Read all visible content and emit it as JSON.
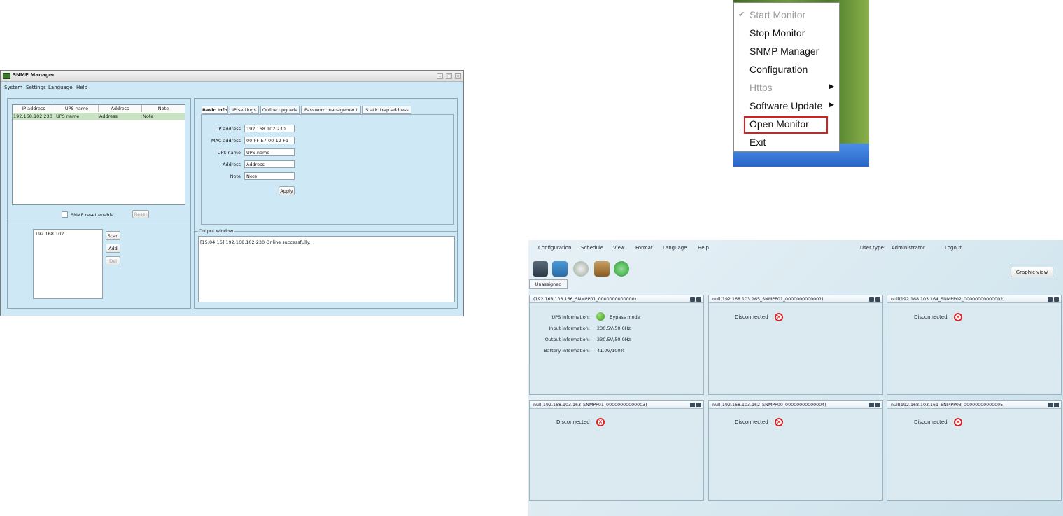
{
  "snmp_manager": {
    "title": "SNMP Manager",
    "menu": [
      "System",
      "Settings",
      "Language",
      "Help"
    ],
    "table": {
      "columns": [
        "IP address",
        "UPS name",
        "Address",
        "Note"
      ],
      "rows": [
        [
          "192.168.102.230",
          "UPS name",
          "Address",
          "Note"
        ]
      ]
    },
    "reset_checkbox_label": "SNMP reset enable",
    "reset_button": "Reset",
    "ip_list": [
      "192.168.102"
    ],
    "scan_button": "Scan",
    "add_button": "Add",
    "del_button": "Del",
    "tabs": [
      "Basic Info",
      "IP settings",
      "Online upgrade",
      "Password management",
      "Static trap address"
    ],
    "fields": [
      {
        "label": "IP address",
        "value": "192.168.102.230"
      },
      {
        "label": "MAC address",
        "value": "00-FF-E7-00-12-F1"
      },
      {
        "label": "UPS name",
        "value": "UPS name"
      },
      {
        "label": "Address",
        "value": "Address"
      },
      {
        "label": "Note",
        "value": "Note"
      }
    ],
    "apply_button": "Apply",
    "output_window_label": "Output window",
    "output_log": "[15:04:16]  192.168.102.230 Online successfully."
  },
  "tray_menu": {
    "items": [
      {
        "label": "Start Monitor",
        "disabled": true,
        "checked": true
      },
      {
        "label": "Stop Monitor"
      },
      {
        "label": "SNMP Manager"
      },
      {
        "label": "Configuration"
      },
      {
        "label": "Https",
        "disabled": true,
        "submenu": true
      },
      {
        "label": "Software Update",
        "submenu": true
      },
      {
        "label": "Open Monitor",
        "highlighted": true
      },
      {
        "label": "Exit"
      }
    ],
    "highlight_color": "#d81e1e"
  },
  "monitor": {
    "menu": [
      "Configuration",
      "Schedule",
      "View",
      "Format",
      "Language",
      "Help"
    ],
    "user_type_label": "User type:",
    "user_type_value": "Administrator",
    "logout": "Logout",
    "graphic_view_button": "Graphic view",
    "group_tab": "Unassigned",
    "cards": [
      {
        "title": "(192.168.103.166_SNMPP01_0000000000000)",
        "status": "online",
        "info": [
          {
            "label": "UPS information:",
            "value": "Bypass mode"
          },
          {
            "label": "Input information:",
            "value": "230.5V/50.0Hz"
          },
          {
            "label": "Output information:",
            "value": "230.5V/50.0Hz"
          },
          {
            "label": "Battery information:",
            "value": "41.0V/100%"
          }
        ]
      },
      {
        "title": "null(192.168.103.165_SNMPP01_0000000000001)",
        "status": "Disconnected"
      },
      {
        "title": "null(192.168.103.164_SNMPP02_00000000000002)",
        "status": "Disconnected"
      },
      {
        "title": "null(192.168.103.163_SNMPP01_00000000000003)",
        "status": "Disconnected"
      },
      {
        "title": "null(192.168.103.162_SNMPP00_00000000000004)",
        "status": "Disconnected"
      },
      {
        "title": "null(192.168.103.161_SNMPP03_00000000000005)",
        "status": "Disconnected"
      }
    ]
  }
}
